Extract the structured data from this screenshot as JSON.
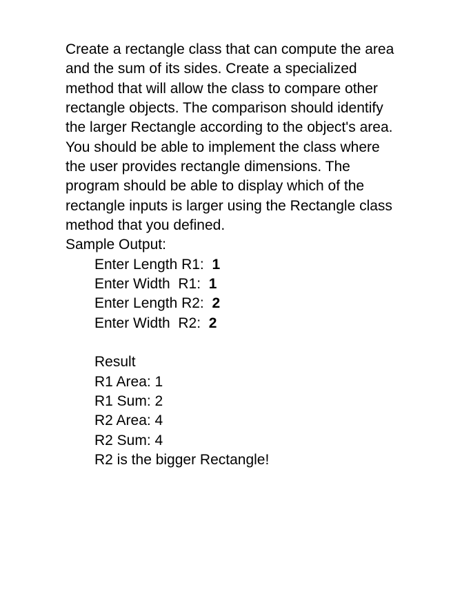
{
  "description": "Create a rectangle class that can compute the area and the sum of its sides.  Create a specialized method that will allow the class to compare other rectangle objects.  The comparison should identify the larger Rectangle according to the object's area.  You should be able to implement the class where the user provides rectangle dimensions.  The program should be able to display which of the rectangle inputs is larger using the Rectangle class method that you defined.",
  "sample_output_label": "Sample Output:",
  "inputs": [
    {
      "label": "Enter Length R1:  ",
      "value": "1"
    },
    {
      "label": "Enter Width  R1:  ",
      "value": "1"
    },
    {
      "label": "Enter Length R2:  ",
      "value": "2"
    },
    {
      "label": "Enter Width  R2:  ",
      "value": "2"
    }
  ],
  "result_header": "Result",
  "results": [
    "R1 Area: 1",
    "R1 Sum: 2",
    "R2 Area: 4",
    "R2 Sum: 4",
    "R2 is the bigger Rectangle!"
  ]
}
